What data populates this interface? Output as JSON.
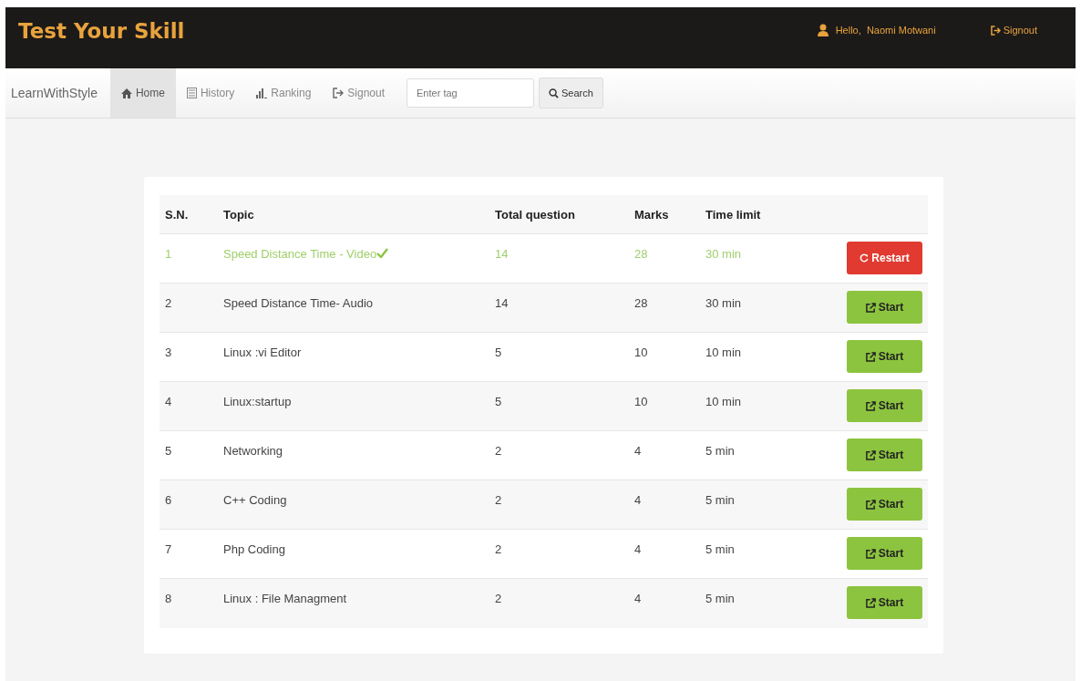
{
  "header": {
    "brand": "Test Your Skill",
    "greeting": "Hello,  Naomi Motwani",
    "signout": "Signout"
  },
  "navbar": {
    "brand": "LearnWithStyle",
    "items": [
      {
        "label": "Home",
        "selected": true
      },
      {
        "label": "History",
        "selected": false
      },
      {
        "label": "Ranking",
        "selected": false
      },
      {
        "label": "Signout",
        "selected": false
      }
    ],
    "search": {
      "placeholder": "Enter tag",
      "button": "Search"
    }
  },
  "table": {
    "columns": [
      "S.N.",
      "Topic",
      "Total question",
      "Marks",
      "Time limit"
    ],
    "rows": [
      {
        "sn": "1",
        "topic": "Speed Distance Time - Video",
        "total": "14",
        "marks": "28",
        "time": "30 min",
        "completed": true,
        "action": "Restart",
        "kind": "restart"
      },
      {
        "sn": "2",
        "topic": "Speed Distance Time- Audio",
        "total": "14",
        "marks": "28",
        "time": "30 min",
        "completed": false,
        "action": "Start",
        "kind": "start"
      },
      {
        "sn": "3",
        "topic": "Linux :vi Editor",
        "total": "5",
        "marks": "10",
        "time": "10 min",
        "completed": false,
        "action": "Start",
        "kind": "start"
      },
      {
        "sn": "4",
        "topic": "Linux:startup",
        "total": "5",
        "marks": "10",
        "time": "10 min",
        "completed": false,
        "action": "Start",
        "kind": "start"
      },
      {
        "sn": "5",
        "topic": "Networking",
        "total": "2",
        "marks": "4",
        "time": "5 min",
        "completed": false,
        "action": "Start",
        "kind": "start"
      },
      {
        "sn": "6",
        "topic": "C++ Coding",
        "total": "2",
        "marks": "4",
        "time": "5 min",
        "completed": false,
        "action": "Start",
        "kind": "start"
      },
      {
        "sn": "7",
        "topic": "Php Coding",
        "total": "2",
        "marks": "4",
        "time": "5 min",
        "completed": false,
        "action": "Start",
        "kind": "start"
      },
      {
        "sn": "8",
        "topic": "Linux : File Managment",
        "total": "2",
        "marks": "4",
        "time": "5 min",
        "completed": false,
        "action": "Start",
        "kind": "start"
      }
    ]
  }
}
